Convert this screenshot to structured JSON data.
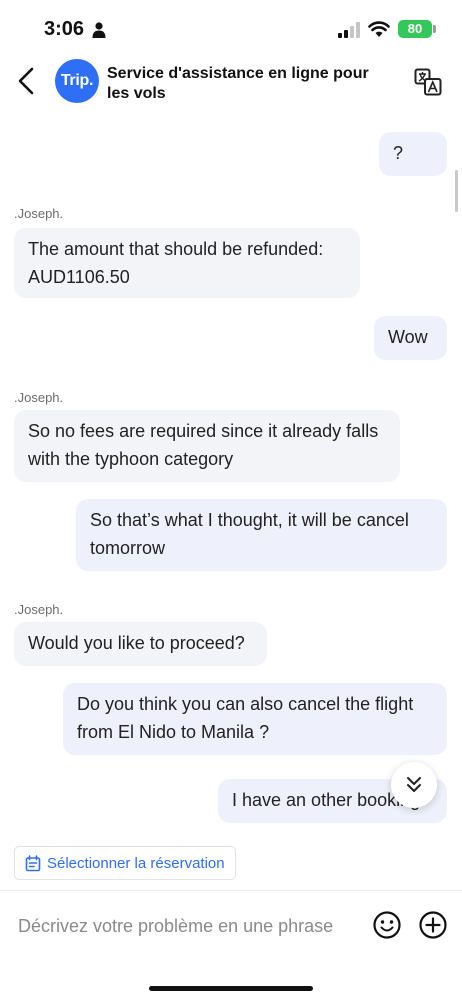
{
  "status_bar": {
    "time": "3:06",
    "battery": "80"
  },
  "header": {
    "logo": "Trip.",
    "title": "Service d'assistance en ligne pour les vols"
  },
  "messages": [
    {
      "from": "user",
      "text": "?"
    },
    {
      "from": "agent",
      "sender": ".Joseph.",
      "text": "The amount that should be refunded: AUD1106.50"
    },
    {
      "from": "user",
      "text": "Wow"
    },
    {
      "from": "agent",
      "sender": ".Joseph.",
      "text": "So no fees are required since it already falls with the typhoon category"
    },
    {
      "from": "user",
      "text": "So that’s what I thought, it will be cancel tomorrow"
    },
    {
      "from": "agent",
      "sender": ".Joseph.",
      "text": "Would you like to proceed?"
    },
    {
      "from": "user",
      "text": "Do you think you can also cancel the flight from El Nido to Manila ?"
    },
    {
      "from": "user",
      "text": "I have an other booking"
    }
  ],
  "select_reservation": {
    "label": "Sélectionner la réservation"
  },
  "input": {
    "placeholder": "Décrivez votre problème en une phrase",
    "value": ""
  },
  "icons": {
    "back": "chevron-left-icon",
    "translate": "translate-icon",
    "scroll_down": "double-chevron-down-icon",
    "calendar": "calendar-icon",
    "emoji": "emoji-icon",
    "plus": "plus-icon"
  },
  "colors": {
    "brand": "#2f6ff5",
    "battery": "#34c759",
    "agent_bubble": "#f2f4f7",
    "user_bubble": "#eef1fb"
  }
}
